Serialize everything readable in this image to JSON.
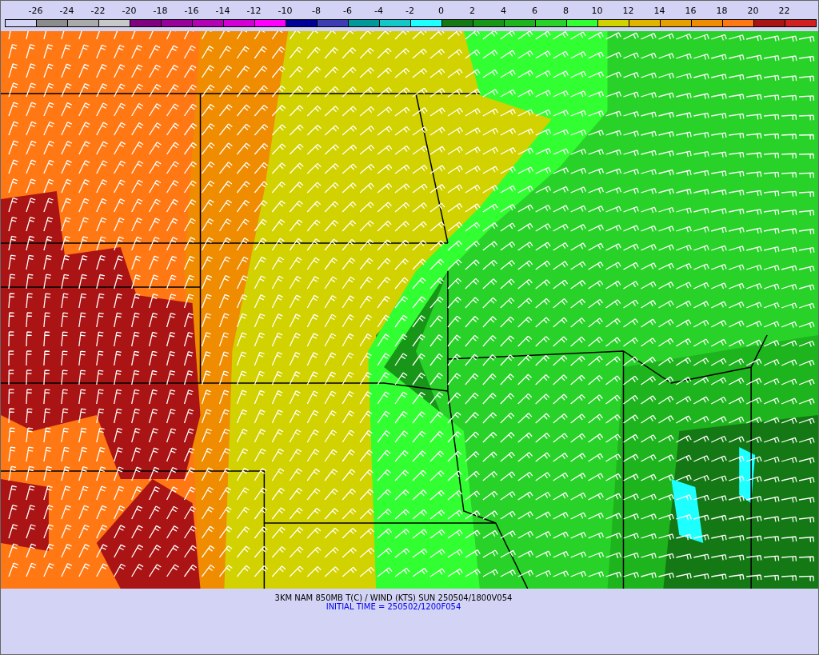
{
  "legend": {
    "labels": [
      "-26",
      "-24",
      "-22",
      "-20",
      "-18",
      "-16",
      "-14",
      "-12",
      "-10",
      "-8",
      "-6",
      "-4",
      "-2",
      "0",
      "2",
      "4",
      "6",
      "8",
      "10",
      "12",
      "14",
      "16",
      "18",
      "20",
      "22"
    ],
    "swatches": [
      {
        "color": "#d3d3f5"
      },
      {
        "color": "#8c8c8c"
      },
      {
        "color": "#aaaaaa"
      },
      {
        "color": "#c8c8c8"
      },
      {
        "color": "#800080"
      },
      {
        "color": "#9a009a"
      },
      {
        "color": "#b400b4"
      },
      {
        "color": "#d200d2"
      },
      {
        "color": "#ff00ff"
      },
      {
        "color": "#000099"
      },
      {
        "color": "#3c3cb4"
      },
      {
        "color": "#009999"
      },
      {
        "color": "#14c8c8"
      },
      {
        "color": "#1effff"
      },
      {
        "color": "#147814"
      },
      {
        "color": "#189618"
      },
      {
        "color": "#1eb41e"
      },
      {
        "color": "#28d228"
      },
      {
        "color": "#32ff32"
      },
      {
        "color": "#d2d200"
      },
      {
        "color": "#e1b400"
      },
      {
        "color": "#e6a000"
      },
      {
        "color": "#f08c00"
      },
      {
        "color": "#ff7814"
      },
      {
        "color": "#aa1414"
      },
      {
        "color": "#d22020"
      }
    ]
  },
  "caption": {
    "title": "3KM NAM 850MB T(C) / WIND (KTS) SUN 250504/1800V054",
    "initial_time": "INITIAL TIME = 250502/1200F054"
  }
}
